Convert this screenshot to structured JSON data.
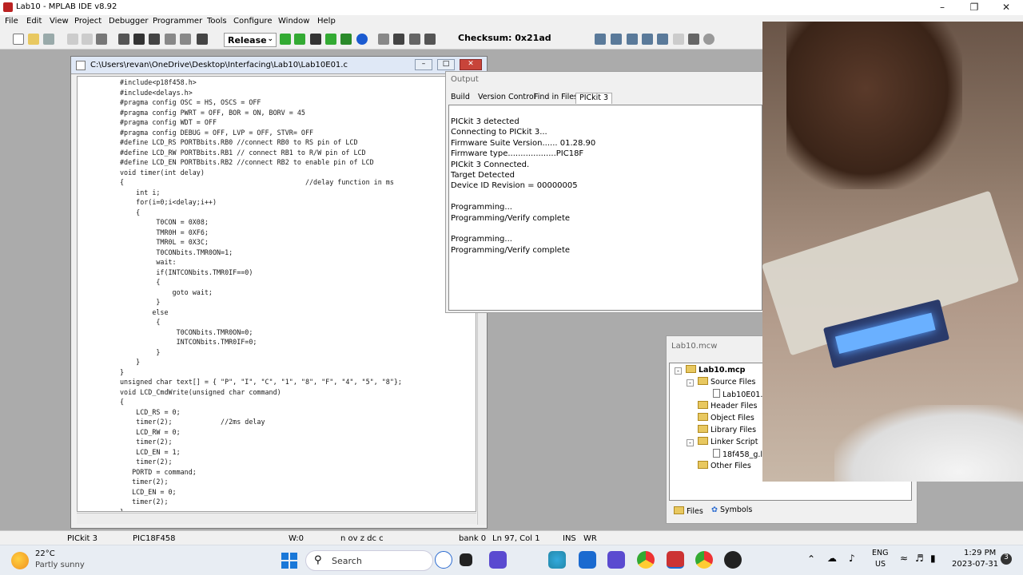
{
  "window": {
    "title": "Lab10 - MPLAB IDE v8.92"
  },
  "menu": [
    "File",
    "Edit",
    "View",
    "Project",
    "Debugger",
    "Programmer",
    "Tools",
    "Configure",
    "Window",
    "Help"
  ],
  "toolbar": {
    "build_config": "Release",
    "checksum": "Checksum:  0x21ad"
  },
  "editor": {
    "title": "C:\\Users\\revan\\OneDrive\\Desktop\\Interfacing\\Lab10\\Lab10E01.c",
    "lines": [
      "#include<p18f458.h>",
      "#include<delays.h>",
      "#pragma config OSC = HS, OSCS = OFF",
      "#pragma config PWRT = OFF, BOR = ON, BORV = 45",
      "#pragma config WDT = OFF",
      "#pragma config DEBUG = OFF, LVP = OFF, STVR= OFF",
      "#define LCD_RS PORTBbits.RB0 //connect RB0 to RS pin of LCD",
      "#define LCD_RW PORTBbits.RB1 // connect RB1 to R/W pin of LCD",
      "#define LCD_EN PORTBbits.RB2 //connect RB2 to enable pin of LCD",
      "void timer(int delay)",
      "{                                             //delay function in ms",
      "    int i;",
      "    for(i=0;i<delay;i++)",
      "    {",
      "         T0CON = 0X08;",
      "         TMR0H = 0XF6;",
      "         TMR0L = 0X3C;",
      "         T0CONbits.TMR0ON=1;",
      "         wait:",
      "         if(INTCONbits.TMR0IF==0)",
      "         {",
      "             goto wait;",
      "         }",
      "        else",
      "         {",
      "              T0CONbits.TMR0ON=0;",
      "              INTCONbits.TMR0IF=0;",
      "         }",
      "    }",
      "}",
      "unsigned char text[] = { \"P\", \"I\", \"C\", \"1\", \"8\", \"F\", \"4\", \"5\", \"8\"};",
      "void LCD_CmdWrite(unsigned char command)",
      "{",
      "    LCD_RS = 0;",
      "    timer(2);            //2ms delay",
      "    LCD_RW = 0;",
      "    timer(2);",
      "    LCD_EN = 1;",
      "    timer(2);",
      "   PORTD = command;",
      "   timer(2);",
      "   LCD_EN = 0;",
      "   timer(2);",
      "}"
    ]
  },
  "output": {
    "title": "Output",
    "tabs": [
      "Build",
      "Version Control",
      "Find in Files",
      "PICkit 3"
    ],
    "active_tab": "PICkit 3",
    "lines": [
      "PICkit 3 detected",
      "Connecting to PICkit 3...",
      "Firmware Suite Version...... 01.28.90",
      "Firmware type...................PIC18F",
      "PICkit 3 Connected.",
      "Target Detected",
      "Device ID Revision = 00000005",
      "",
      "Programming...",
      "Programming/Verify complete",
      "",
      "Programming...",
      "Programming/Verify complete"
    ]
  },
  "project": {
    "title": "Lab10.mcw",
    "root": "Lab10.mcp",
    "items": [
      "Source Files",
      "Lab10E01.c",
      "Header Files",
      "Object Files",
      "Library Files",
      "Linker Script",
      "18f458_g.lkr",
      "Other Files"
    ],
    "tabs": [
      "Files",
      "Symbols"
    ]
  },
  "status": [
    "PICkit 3",
    "PIC18F458",
    "W:0",
    "n ov z dc c",
    "bank 0",
    "Ln 97, Col 1",
    "INS",
    "WR"
  ],
  "taskbar": {
    "temp": "22°C",
    "weather": "Partly sunny",
    "search": "Search",
    "lang1": "ENG",
    "lang2": "US",
    "time": "1:29 PM",
    "date": "2023-07-31",
    "notif": "3"
  }
}
